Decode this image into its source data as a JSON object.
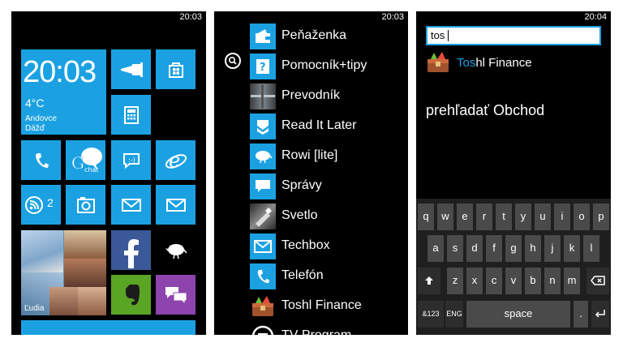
{
  "start_screen": {
    "clock": "20:03",
    "weather_tile": {
      "time": "20:03",
      "temperature": "4°C",
      "location": "Andovce",
      "condition": "Dážď"
    },
    "tiles": {
      "flashlight": "flashlight-icon",
      "store": "store-icon",
      "calculator": "calculator-icon",
      "phone": "phone-icon",
      "gchat": "gchat-icon",
      "messaging": "messaging-icon",
      "internet_explorer": "internet-explorer-icon",
      "rss": "rss-icon",
      "rss_count": "2",
      "photos": "photos-icon",
      "mail_1": "mail-icon",
      "mail_2": "mail-icon",
      "people_label": "Ľudia",
      "facebook": "facebook-icon",
      "rowi": "bird-icon",
      "evernote": "evernote-icon",
      "chat": "chat-icon"
    },
    "accent_color": "#1ba1e2"
  },
  "app_list": {
    "clock": "20:03",
    "search_icon": "search-icon",
    "apps": [
      {
        "label": "Peňaženka",
        "icon": "wallet-icon"
      },
      {
        "label": "Pomocník+tipy",
        "icon": "help-icon"
      },
      {
        "label": "Prevodník",
        "icon": "converter-icon"
      },
      {
        "label": "Read It Later",
        "icon": "read-it-later-icon"
      },
      {
        "label": "Rowi [lite]",
        "icon": "bird-icon"
      },
      {
        "label": "Správy",
        "icon": "messaging-icon"
      },
      {
        "label": "Svetlo",
        "icon": "flashlight-icon"
      },
      {
        "label": "Techbox",
        "icon": "mail-icon"
      },
      {
        "label": "Telefón",
        "icon": "phone-icon"
      },
      {
        "label": "Toshl Finance",
        "icon": "toshl-icon"
      },
      {
        "label": "TV Program",
        "icon": "tv-icon"
      }
    ]
  },
  "search_screen": {
    "clock": "20:04",
    "query": "tos",
    "result": {
      "match": "Tos",
      "rest": "hl Finance",
      "icon": "toshl-icon"
    },
    "store_search": "prehľadať Obchod",
    "keyboard": {
      "row1": [
        "q",
        "w",
        "e",
        "r",
        "t",
        "y",
        "u",
        "i",
        "o",
        "p"
      ],
      "row2": [
        "a",
        "s",
        "d",
        "f",
        "g",
        "h",
        "j",
        "k",
        "l"
      ],
      "row3": [
        "z",
        "x",
        "c",
        "v",
        "b",
        "n",
        "m"
      ],
      "shift": "shift-icon",
      "backspace": "backspace-icon",
      "numbers": "&123",
      "language": "ENG",
      "space": "space",
      "period": ".",
      "enter": "enter-icon"
    }
  }
}
